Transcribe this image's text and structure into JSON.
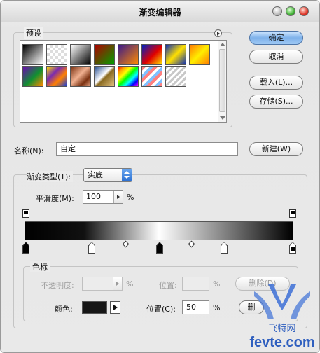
{
  "window": {
    "title": "渐变编辑器"
  },
  "presets": {
    "label": "预设",
    "swatches": [
      {
        "name": "black-white",
        "bg": "linear-gradient(135deg,#000,#fff)"
      },
      {
        "name": "transparent-checker",
        "bg": "repeating-conic-gradient(#ddd 0 25%,#fff 0 50%) 0 0/8px 8px"
      },
      {
        "name": "white-black",
        "bg": "linear-gradient(135deg,#fff,#000)"
      },
      {
        "name": "red-green",
        "bg": "linear-gradient(135deg,#b00000,#00a000)"
      },
      {
        "name": "violet-orange",
        "bg": "linear-gradient(135deg,#3a1a8a,#ff8a00)"
      },
      {
        "name": "blue-red-yellow",
        "bg": "linear-gradient(135deg,#0020c0,#e00000 55%,#ffe000)"
      },
      {
        "name": "blue-yellow-blue",
        "bg": "linear-gradient(135deg,#1030b0,#ffe000 50%,#1030b0)"
      },
      {
        "name": "orange-yellow-orange",
        "bg": "linear-gradient(135deg,#ff7a00,#ffee00 50%,#ff7a00)"
      },
      {
        "name": "violet-green-orange",
        "bg": "linear-gradient(135deg,#6a0ab0,#109030 55%,#ff8a00)"
      },
      {
        "name": "yellow-violet-orange-blue",
        "bg": "linear-gradient(135deg,#ffe000,#7a2ab0 35%,#ff8000 65%,#2040d0)"
      },
      {
        "name": "copper",
        "bg": "linear-gradient(135deg,#7a3010,#f0b090 45%,#7a3010 75%,#e0a080)"
      },
      {
        "name": "chrome",
        "bg": "linear-gradient(135deg,#204a90,#ffffff 45%,#8a6a20 55%,#e0c080)"
      },
      {
        "name": "spectrum",
        "bg": "linear-gradient(135deg,red,orange,yellow,lime,cyan,blue,magenta)"
      },
      {
        "name": "transparent-rainbow",
        "bg": "repeating-linear-gradient(135deg,#ff8080 0 4px,#ffffff 4px 8px,#80c0ff 8px 12px)"
      },
      {
        "name": "transparent-stripes",
        "bg": "repeating-linear-gradient(135deg,#c8c8c8 0 3px,#ffffff 3px 6px)"
      }
    ]
  },
  "buttons": {
    "ok": "确定",
    "cancel": "取消",
    "load": "载入(L)...",
    "save": "存储(S)...",
    "new": "新建(W)",
    "delete": "删除(D)",
    "delete_partial": "删"
  },
  "name_field": {
    "label": "名称(N):",
    "value": "自定"
  },
  "gradient_type": {
    "label": "渐变类型(T):",
    "value": "实底"
  },
  "smoothness": {
    "label": "平滑度(M):",
    "value": "100",
    "unit": "%"
  },
  "color_stops": {
    "group_label": "色标",
    "opacity_label": "不透明度:",
    "opacity_unit": "%",
    "location_label_disabled": "位置:",
    "location_unit_disabled": "%",
    "color_label": "颜色:",
    "location_label": "位置(C):",
    "location_value": "50",
    "location_unit": "%",
    "selected_color": "#161616"
  },
  "watermark": {
    "text": "fevte.com",
    "sub": "飞特网"
  }
}
